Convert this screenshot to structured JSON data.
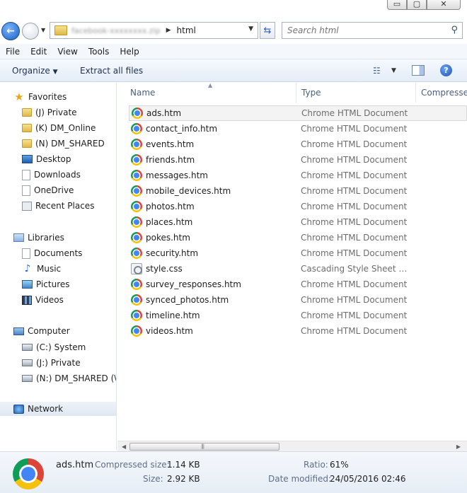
{
  "window": {
    "min_glyph": "▭",
    "max_glyph": "▢",
    "close_glyph": "✕"
  },
  "address": {
    "previous_crumb": "facebook-xxxxxxxx.zip",
    "current_folder": "html"
  },
  "search": {
    "placeholder": "Search html",
    "value": ""
  },
  "menu": [
    "File",
    "Edit",
    "View",
    "Tools",
    "Help"
  ],
  "toolbar": {
    "organize": "Organize",
    "extract": "Extract all files"
  },
  "nav": {
    "favorites_label": "Favorites",
    "favorites": [
      "(J) Private",
      "(K) DM_Online",
      "(N) DM_SHARED",
      "Desktop",
      "Downloads",
      "OneDrive",
      "Recent Places"
    ],
    "libraries_label": "Libraries",
    "libraries": [
      "Documents",
      "Music",
      "Pictures",
      "Videos"
    ],
    "computer_label": "Computer",
    "drives": [
      "(C:) System",
      "(J:) Private",
      "(N:) DM_SHARED (\\\\"
    ],
    "network_label": "Network"
  },
  "columns": {
    "name": "Name",
    "type": "Type",
    "compressed": "Compresse"
  },
  "files": [
    {
      "name": "ads.htm",
      "type": "Chrome HTML Document",
      "icon": "chrome-icon"
    },
    {
      "name": "contact_info.htm",
      "type": "Chrome HTML Document",
      "icon": "chrome-icon"
    },
    {
      "name": "events.htm",
      "type": "Chrome HTML Document",
      "icon": "chrome-icon"
    },
    {
      "name": "friends.htm",
      "type": "Chrome HTML Document",
      "icon": "chrome-icon"
    },
    {
      "name": "messages.htm",
      "type": "Chrome HTML Document",
      "icon": "chrome-icon"
    },
    {
      "name": "mobile_devices.htm",
      "type": "Chrome HTML Document",
      "icon": "chrome-icon"
    },
    {
      "name": "photos.htm",
      "type": "Chrome HTML Document",
      "icon": "chrome-icon"
    },
    {
      "name": "places.htm",
      "type": "Chrome HTML Document",
      "icon": "chrome-icon"
    },
    {
      "name": "pokes.htm",
      "type": "Chrome HTML Document",
      "icon": "chrome-icon"
    },
    {
      "name": "security.htm",
      "type": "Chrome HTML Document",
      "icon": "chrome-icon"
    },
    {
      "name": "style.css",
      "type": "Cascading Style Sheet Do...",
      "icon": "css-file-icon"
    },
    {
      "name": "survey_responses.htm",
      "type": "Chrome HTML Document",
      "icon": "chrome-icon"
    },
    {
      "name": "synced_photos.htm",
      "type": "Chrome HTML Document",
      "icon": "chrome-icon"
    },
    {
      "name": "timeline.htm",
      "type": "Chrome HTML Document",
      "icon": "chrome-icon"
    },
    {
      "name": "videos.htm",
      "type": "Chrome HTML Document",
      "icon": "chrome-icon"
    }
  ],
  "selected_file": "ads.htm",
  "details": {
    "filename": "ads.htm",
    "compressed_label": "Compressed size:",
    "compressed_value": "1.14 KB",
    "size_label": "Size:",
    "size_value": "2.92 KB",
    "ratio_label": "Ratio:",
    "ratio_value": "61%",
    "modified_label": "Date modified:",
    "modified_value": "24/05/2016 02:46"
  },
  "colors": {
    "selection_bg": "#f3f3f3",
    "toolbar_text": "#1e3050",
    "type_text": "#6d6d6d"
  }
}
